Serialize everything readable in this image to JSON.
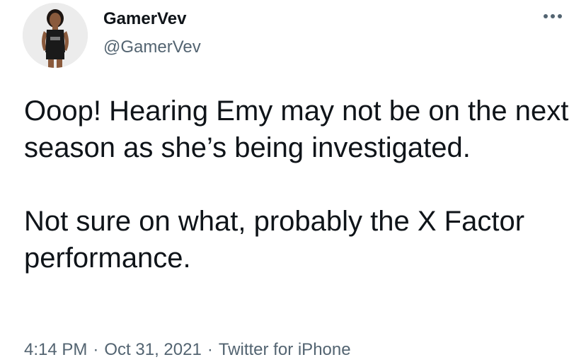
{
  "author": {
    "display_name": "GamerVev",
    "handle": "@GamerVev"
  },
  "tweet": {
    "paragraph_1": "Ooop! Hearing Emy may not be on the next season as she’s being investigated.",
    "paragraph_2": "Not sure on what, probably the X Factor performance."
  },
  "meta": {
    "time": "4:14 PM",
    "separator": "·",
    "date": "Oct 31, 2021",
    "source": "Twitter for iPhone"
  },
  "icons": {
    "more": "more-options-icon",
    "avatar": "profile-photo"
  },
  "colors": {
    "text": "#0f1419",
    "secondary": "#536471",
    "background": "#ffffff"
  }
}
